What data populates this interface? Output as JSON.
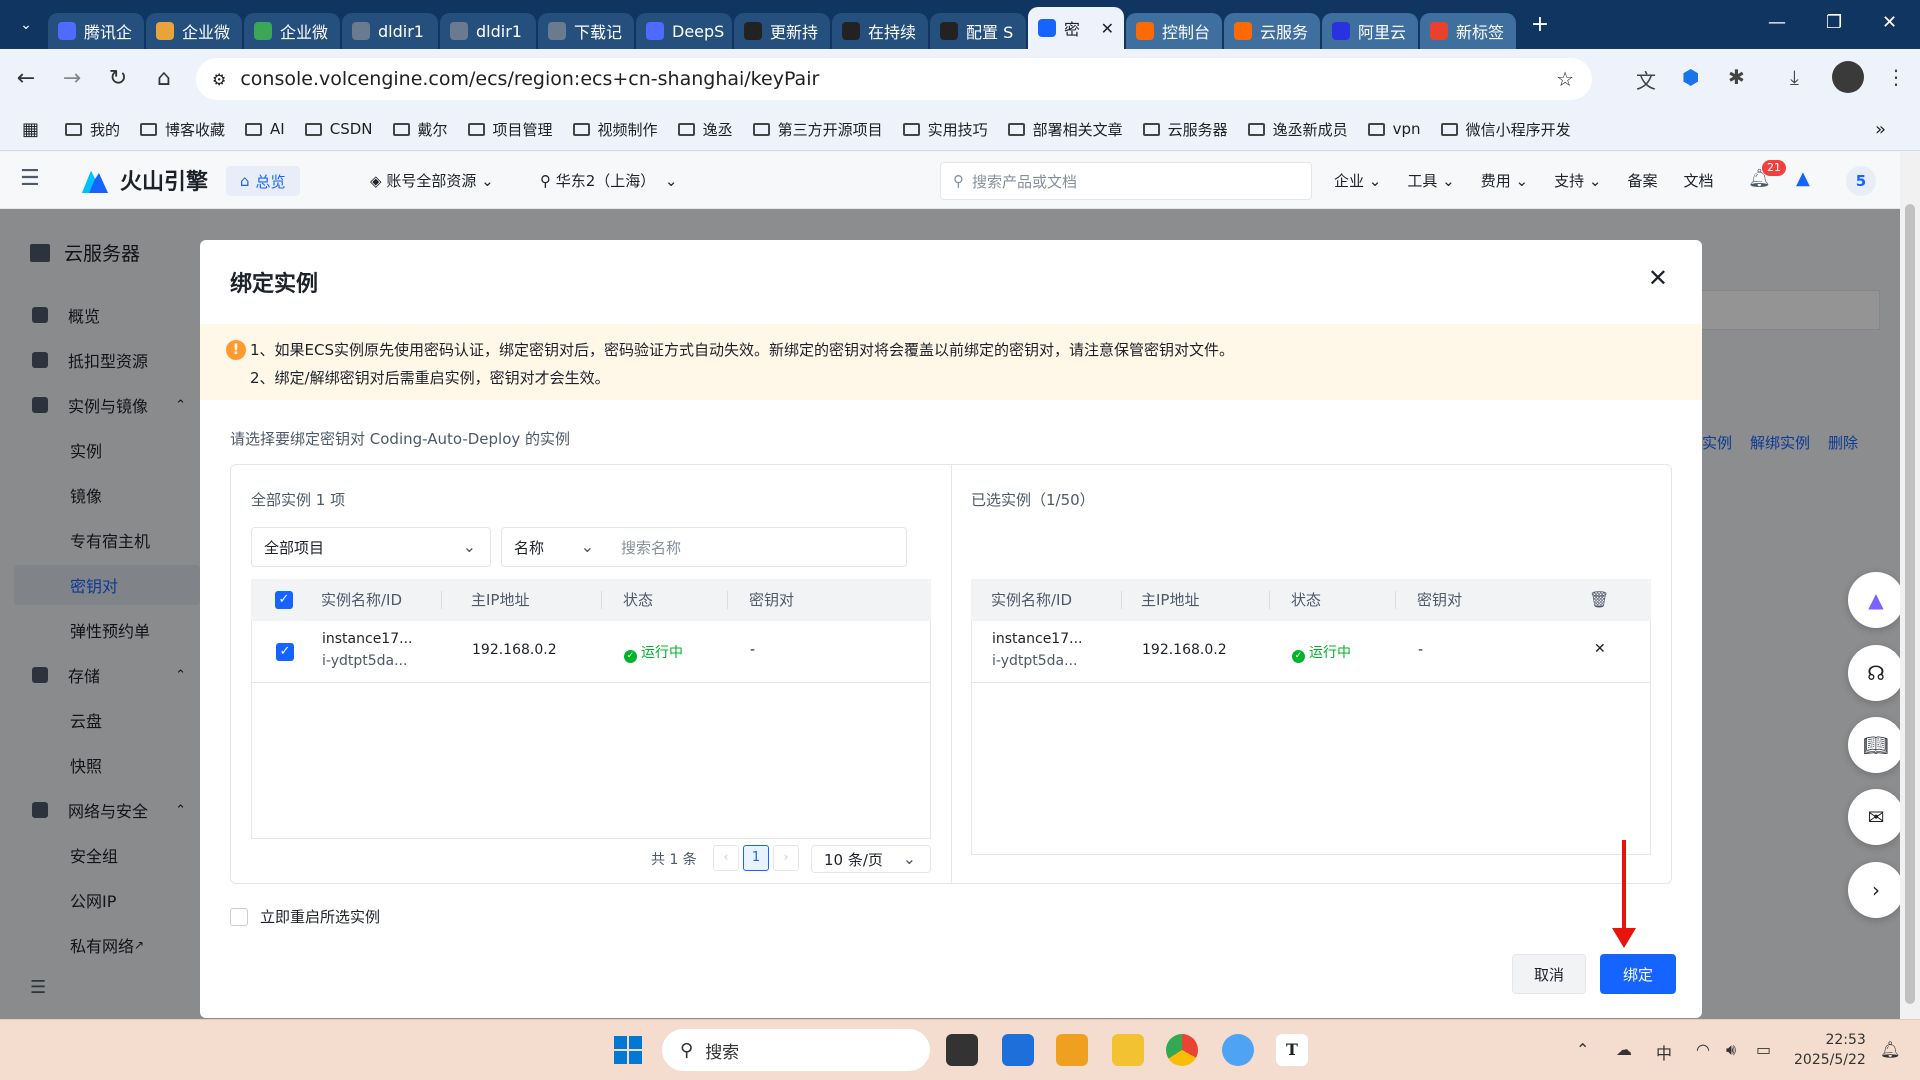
{
  "browser": {
    "tabs": [
      {
        "title": "腾讯企",
        "favicon": "tencent-icon",
        "color": "#4d6cff"
      },
      {
        "title": "企业微",
        "favicon": "wecom-icon",
        "color": "#e8a33a"
      },
      {
        "title": "企业微",
        "favicon": "wecom-doc-icon",
        "color": "#3aa656"
      },
      {
        "title": "dldir1",
        "favicon": "globe-icon",
        "color": "#6a7b8f"
      },
      {
        "title": "dldir1",
        "favicon": "globe-icon",
        "color": "#6a7b8f"
      },
      {
        "title": "下载记",
        "favicon": "download-icon",
        "color": "#6a7b8f"
      },
      {
        "title": "DeepS",
        "favicon": "deepseek-icon",
        "color": "#4d6bfe"
      },
      {
        "title": "更新持",
        "favicon": "github-icon",
        "color": "#222"
      },
      {
        "title": "在持续",
        "favicon": "github-icon",
        "color": "#222"
      },
      {
        "title": "配置 S",
        "favicon": "github-icon",
        "color": "#222"
      },
      {
        "title": "密",
        "favicon": "volcengine-icon",
        "color": "#1664ff"
      },
      {
        "title": "控制台",
        "favicon": "aliyun-icon",
        "color": "#ff6a00"
      },
      {
        "title": "云服务",
        "favicon": "aliyun-icon",
        "color": "#ff6a00"
      },
      {
        "title": "阿里云",
        "favicon": "baidu-icon",
        "color": "#2932e1"
      },
      {
        "title": "新标签",
        "favicon": "newtab-icon",
        "color": "#e8412c"
      }
    ],
    "url": "console.volcengine.com/ecs/region:ecs+cn-shanghai/keyPair",
    "bookmarks": [
      "我的",
      "博客收藏",
      "AI",
      "CSDN",
      "戴尔",
      "项目管理",
      "视频制作",
      "逸丞",
      "第三方开源项目",
      "实用技巧",
      "部署相关文章",
      "云服务器",
      "逸丞新成员",
      "vpn",
      "微信小程序开发"
    ]
  },
  "header": {
    "logo": "火山引擎",
    "overview": "总览",
    "account": "账号全部资源",
    "region": "华东2（上海）",
    "search_placeholder": "搜索产品或文档",
    "nav": [
      "企业",
      "工具",
      "费用",
      "支持",
      "备案",
      "文档"
    ],
    "notify_count": "21",
    "avatar": "5"
  },
  "sidebar": {
    "title": "云服务器",
    "items": [
      {
        "label": "概览",
        "group": true
      },
      {
        "label": "抵扣型资源",
        "group": true
      },
      {
        "label": "实例与镜像",
        "group": true
      },
      {
        "label": "实例",
        "group": false
      },
      {
        "label": "镜像",
        "group": false
      },
      {
        "label": "专有宿主机",
        "group": false
      },
      {
        "label": "密钥对",
        "group": false
      },
      {
        "label": "弹性预约单",
        "group": false
      },
      {
        "label": "存储",
        "group": true
      },
      {
        "label": "云盘",
        "group": false
      },
      {
        "label": "快照",
        "group": false
      },
      {
        "label": "网络与安全",
        "group": true
      },
      {
        "label": "安全组",
        "group": false
      },
      {
        "label": "公网IP",
        "group": false
      },
      {
        "label": "私有网络",
        "group": false
      }
    ]
  },
  "background_links": [
    "实例",
    "解绑实例",
    "删除"
  ],
  "dialog": {
    "title": "绑定实例",
    "notice_line1": "1、如果ECS实例原先使用密码认证，绑定密钥对后，密码验证方式自动失效。新绑定的密钥对将会覆盖以前绑定的密钥对，请注意保管密钥对文件。",
    "notice_line2": "2、绑定/解绑密钥对后需重启实例，密钥对才会生效。",
    "prompt": "请选择要绑定密钥对 Coding-Auto-Deploy 的实例",
    "left": {
      "title": "全部实例 1 项",
      "project_select": "全部项目",
      "field_select": "名称",
      "search_placeholder": "搜索名称",
      "columns": [
        "实例名称/ID",
        "主IP地址",
        "状态",
        "密钥对"
      ],
      "rows": [
        {
          "name": "instance17...",
          "id": "i-ydtpt5da...",
          "ip": "192.168.0.2",
          "status": "运行中",
          "keypair": "-"
        }
      ],
      "total": "共 1 条",
      "page": "1",
      "page_size": "10 条/页"
    },
    "right": {
      "title": "已选实例（1/50）",
      "columns": [
        "实例名称/ID",
        "主IP地址",
        "状态",
        "密钥对"
      ],
      "rows": [
        {
          "name": "instance17...",
          "id": "i-ydtpt5da...",
          "ip": "192.168.0.2",
          "status": "运行中",
          "keypair": "-"
        }
      ]
    },
    "reboot_label": "立即重启所选实例",
    "cancel": "取消",
    "confirm": "绑定"
  },
  "taskbar": {
    "search": "搜索",
    "ime": "中",
    "time": "22:53",
    "date": "2025/5/22"
  }
}
